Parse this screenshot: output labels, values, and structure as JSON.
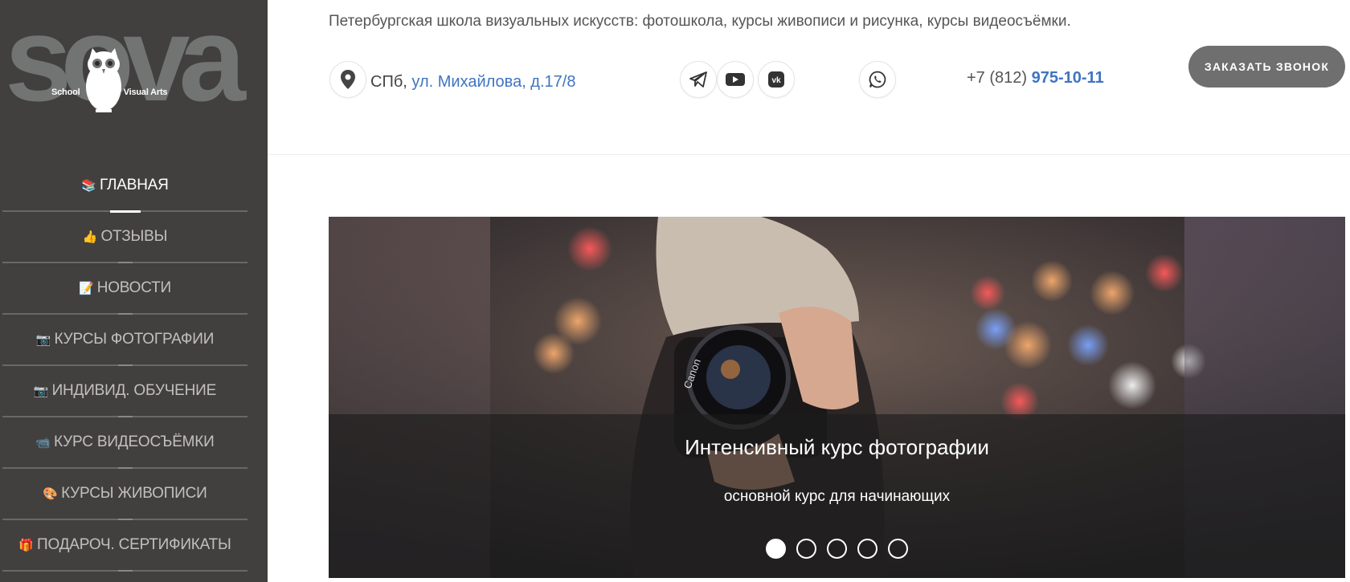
{
  "logo": {
    "word": "sova",
    "tagline_left": "School",
    "tagline_right": "Of Visual Arts"
  },
  "nav": {
    "items": [
      {
        "icon": "📚",
        "label": "ГЛАВНАЯ",
        "active": true
      },
      {
        "icon": "👍",
        "label": "ОТЗЫВЫ"
      },
      {
        "icon": "📝",
        "label": "НОВОСТИ"
      },
      {
        "icon": "📷",
        "label": "КУРСЫ ФОТОГРАФИИ"
      },
      {
        "icon": "📷",
        "label": "ИНДИВИД. ОБУЧЕНИЕ"
      },
      {
        "icon": "📹",
        "label": "КУРС ВИДЕОСЪЁМКИ"
      },
      {
        "icon": "🎨",
        "label": "КУРСЫ ЖИВОПИСИ"
      },
      {
        "icon": "🎁",
        "label": "ПОДАРОЧ. СЕРТИФИКАТЫ"
      }
    ]
  },
  "header": {
    "tagline": "Петербургская школа визуальных искусств: фотошкола, курсы живописи и рисунка, курсы видеосъёмки.",
    "address_prefix": "СПб,",
    "address_link": "ул. Михайлова, д.17/8",
    "phone_prefix": "+7 (812)",
    "phone_number": "975-10-11",
    "cta_label": "ЗАКАЗАТЬ ЗВОНОК",
    "social": [
      {
        "name": "telegram-icon"
      },
      {
        "name": "youtube-icon"
      },
      {
        "name": "vk-icon"
      },
      {
        "name": "whatsapp-icon"
      }
    ]
  },
  "slider": {
    "title": "Интенсивный курс фотографии",
    "subtitle": "основной курс для начинающих",
    "slide_count": 5,
    "active_index": 0
  },
  "colors": {
    "sidebar_bg": "#423f3f",
    "accent_link": "#3f74c2",
    "cta_bg": "#6f6f6f"
  }
}
